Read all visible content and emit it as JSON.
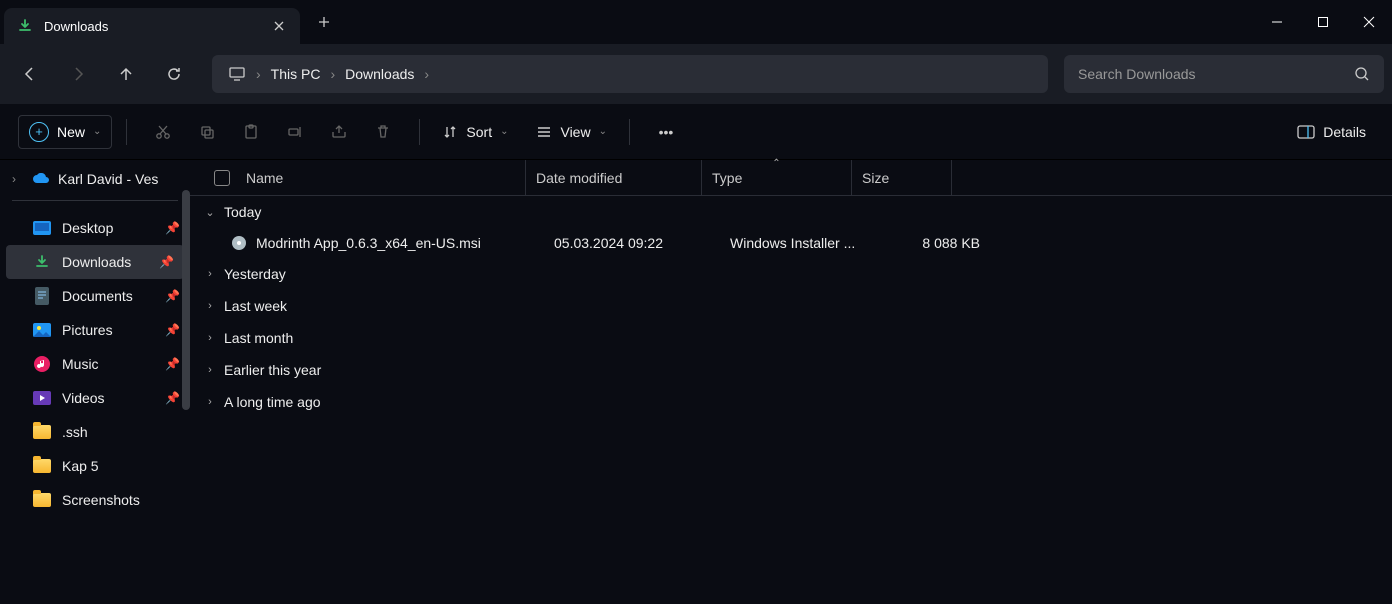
{
  "tab": {
    "title": "Downloads"
  },
  "breadcrumbs": {
    "thispc": "This PC",
    "downloads": "Downloads"
  },
  "search": {
    "placeholder": "Search Downloads"
  },
  "toolbar": {
    "new": "New",
    "sort": "Sort",
    "view": "View",
    "details": "Details"
  },
  "sidebar": {
    "user": "Karl David - Ves",
    "items": [
      {
        "label": "Desktop",
        "icon": "desktop",
        "pinned": true
      },
      {
        "label": "Downloads",
        "icon": "download",
        "pinned": true,
        "active": true
      },
      {
        "label": "Documents",
        "icon": "document",
        "pinned": true
      },
      {
        "label": "Pictures",
        "icon": "picture",
        "pinned": true
      },
      {
        "label": "Music",
        "icon": "music",
        "pinned": true
      },
      {
        "label": "Videos",
        "icon": "video",
        "pinned": true
      },
      {
        "label": ".ssh",
        "icon": "folder",
        "pinned": false
      },
      {
        "label": "Kap 5",
        "icon": "folder",
        "pinned": false
      },
      {
        "label": "Screenshots",
        "icon": "folder",
        "pinned": false
      }
    ]
  },
  "columns": {
    "name": "Name",
    "date": "Date modified",
    "type": "Type",
    "size": "Size"
  },
  "groups": {
    "today": "Today",
    "yesterday": "Yesterday",
    "lastweek": "Last week",
    "lastmonth": "Last month",
    "earlier": "Earlier this year",
    "longtime": "A long time ago"
  },
  "file": {
    "name": "Modrinth App_0.6.3_x64_en-US.msi",
    "date": "05.03.2024 09:22",
    "type": "Windows Installer ...",
    "size": "8 088 KB"
  }
}
